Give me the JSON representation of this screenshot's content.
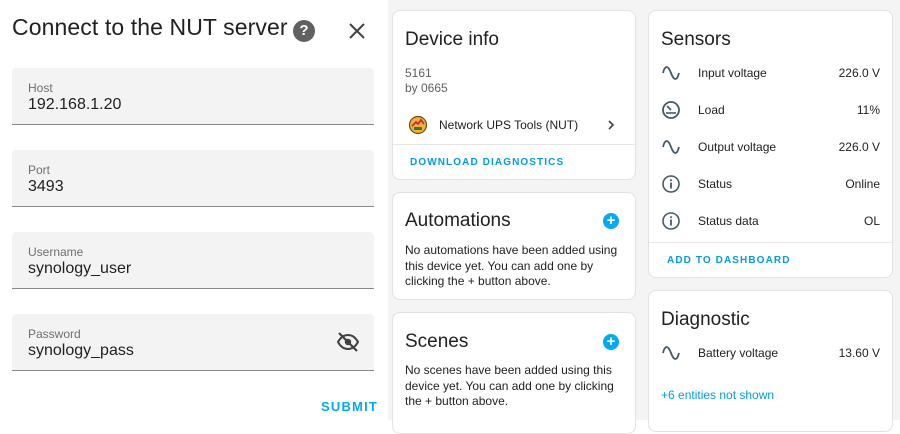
{
  "dialog": {
    "title": "Connect to the NUT server",
    "fields": [
      {
        "label": "Host",
        "value": "192.168.1.20"
      },
      {
        "label": "Port",
        "value": "3493"
      },
      {
        "label": "Username",
        "value": "synology_user"
      },
      {
        "label": "Password",
        "value": "synology_pass"
      }
    ],
    "submit_label": "SUBMIT"
  },
  "device_info": {
    "title": "Device info",
    "model": "5161",
    "manufacturer": "by 0665",
    "integration": "Network UPS Tools (NUT)",
    "download_label": "DOWNLOAD DIAGNOSTICS"
  },
  "automations": {
    "title": "Automations",
    "text": "No automations have been added using this device yet. You can add one by clicking the + button above."
  },
  "scenes": {
    "title": "Scenes",
    "text": "No scenes have been added using this device yet. You can add one by clicking the + button above."
  },
  "sensors": {
    "title": "Sensors",
    "rows": [
      {
        "name": "Input voltage",
        "value": "226.0 V",
        "icon": "sine-wave-icon"
      },
      {
        "name": "Load",
        "value": "11%",
        "icon": "gauge-icon"
      },
      {
        "name": "Output voltage",
        "value": "226.0 V",
        "icon": "sine-wave-icon"
      },
      {
        "name": "Status",
        "value": "Online",
        "icon": "info-icon"
      },
      {
        "name": "Status data",
        "value": "OL",
        "icon": "info-icon"
      }
    ],
    "add_label": "ADD TO DASHBOARD"
  },
  "diagnostic": {
    "title": "Diagnostic",
    "rows": [
      {
        "name": "Battery voltage",
        "value": "13.60 V",
        "icon": "sine-wave-icon"
      }
    ],
    "more_label": "+6 entities not shown"
  },
  "colors": {
    "accent": "#03a9f4",
    "field_bg": "#f3f3f3",
    "page_bg": "#f4f4f4"
  }
}
